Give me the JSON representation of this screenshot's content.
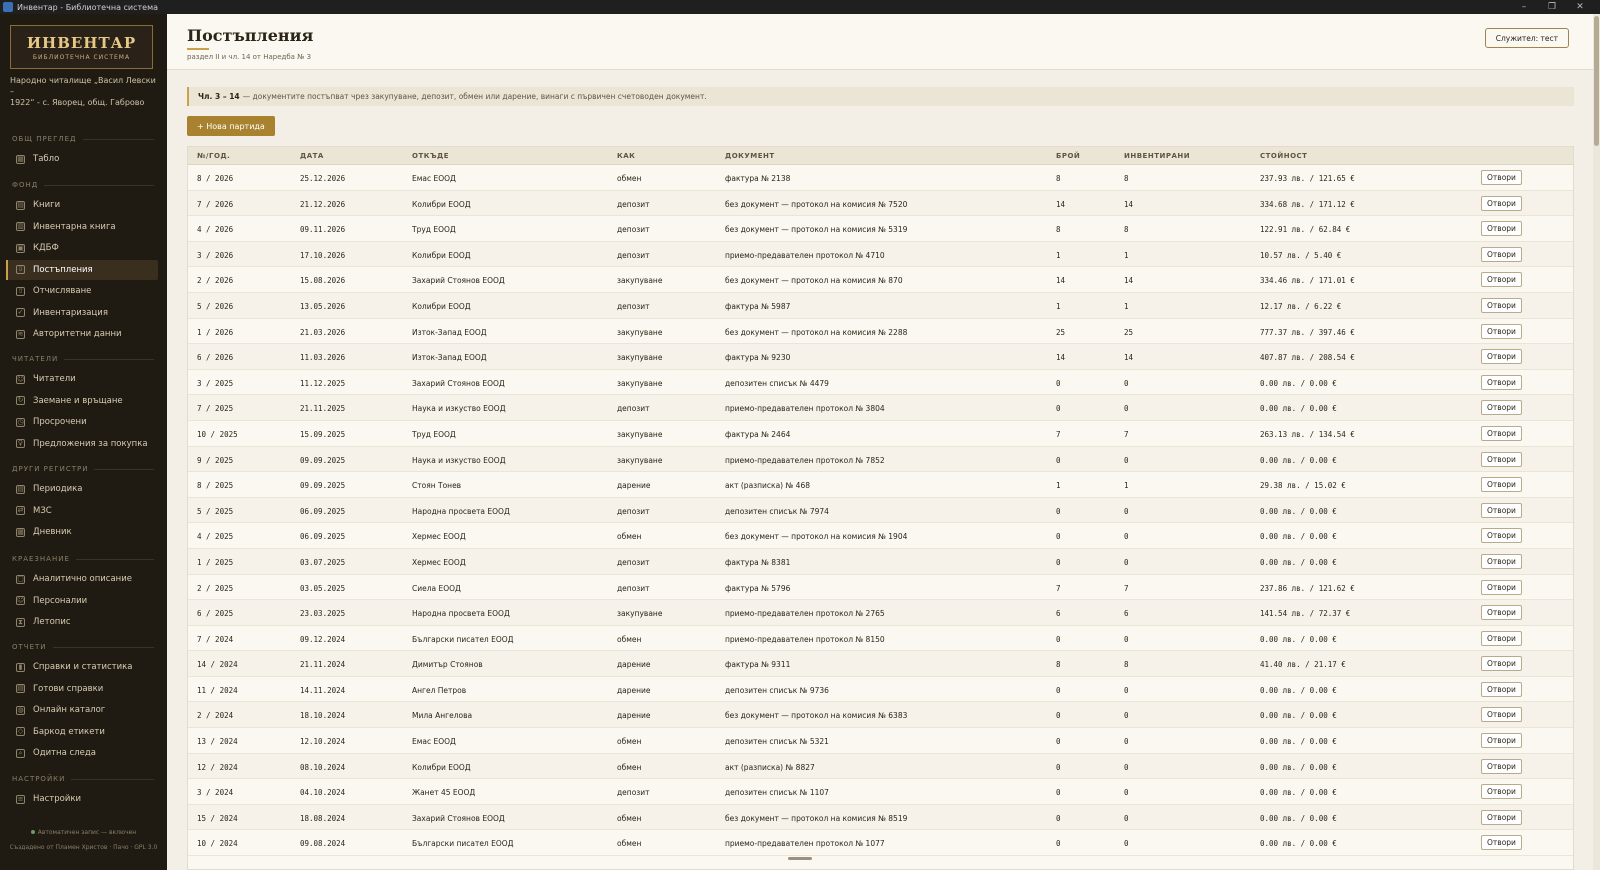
{
  "window": {
    "title": "Инвентар - Библиотечна система",
    "controls": [
      "–",
      "❐",
      "✕"
    ]
  },
  "sidebar": {
    "logo_title": "ИНВЕНТАР",
    "logo_subtitle": "БИБЛИОТЕЧНА СИСТЕМА",
    "org_line1": "Народно читалище „Васил Левски –",
    "org_line2": "1922“ - с. Яворец, общ. Габрово",
    "sections": [
      {
        "label": "ОБЩ ПРЕГЛЕД",
        "items": [
          {
            "label": "Табло",
            "icon": "dashboard-icon"
          }
        ]
      },
      {
        "label": "ФОНД",
        "items": [
          {
            "label": "Книги",
            "icon": "book-icon"
          },
          {
            "label": "Инвентарна книга",
            "icon": "ledger-icon"
          },
          {
            "label": "КДБФ",
            "icon": "card-icon"
          },
          {
            "label": "Постъпления",
            "icon": "inbox-icon"
          },
          {
            "label": "Отчисляване",
            "icon": "outbox-icon"
          },
          {
            "label": "Инвентаризация",
            "icon": "checklist-icon"
          },
          {
            "label": "Авторитетни данни",
            "icon": "layers-icon"
          }
        ]
      },
      {
        "label": "ЧИТАТЕЛИ",
        "items": [
          {
            "label": "Читатели",
            "icon": "users-icon"
          },
          {
            "label": "Заемане и връщане",
            "icon": "refresh-icon"
          },
          {
            "label": "Просрочени",
            "icon": "clock-icon"
          },
          {
            "label": "Предложения за покупка",
            "icon": "bulb-icon"
          }
        ]
      },
      {
        "label": "ДРУГИ РЕГИСТРИ",
        "items": [
          {
            "label": "Периодика",
            "icon": "newspaper-icon"
          },
          {
            "label": "МЗС",
            "icon": "exchange-icon"
          },
          {
            "label": "Дневник",
            "icon": "calendar-icon"
          }
        ]
      },
      {
        "label": "КРАЕЗНАНИЕ",
        "items": [
          {
            "label": "Аналитично описание",
            "icon": "document-icon"
          },
          {
            "label": "Персоналии",
            "icon": "person-icon"
          },
          {
            "label": "Летопис",
            "icon": "hourglass-icon"
          }
        ]
      },
      {
        "label": "ОТЧЕТИ",
        "items": [
          {
            "label": "Справки и статистика",
            "icon": "chart-icon"
          },
          {
            "label": "Готови справки",
            "icon": "report-icon"
          },
          {
            "label": "Онлайн каталог",
            "icon": "globe-icon"
          },
          {
            "label": "Баркод етикети",
            "icon": "tag-icon"
          },
          {
            "label": "Одитна следа",
            "icon": "search-icon"
          }
        ]
      },
      {
        "label": "НАСТРОЙКИ",
        "items": [
          {
            "label": "Настройки",
            "icon": "sliders-icon"
          }
        ]
      }
    ],
    "active_item": "Постъпления",
    "footer_status": "Автоматичен запис — включен",
    "footer_credits": "Създадено от Пламен Христов · Пачо · GPL 3.0"
  },
  "header": {
    "title": "Постъпления",
    "subtitle": "раздел II и чл. 14 от Наредба № 3",
    "user_button": "Служител: тест"
  },
  "note": {
    "bold": "Чл. 3 – 14",
    "text": "— документите постъпват чрез закупуване, депозит, обмен или дарение, винаги с първичен счетоводен документ."
  },
  "new_button": "+ Нова партида",
  "table": {
    "columns": [
      "№/ГОД.",
      "ДАТА",
      "ОТКЪДЕ",
      "КАК",
      "ДОКУМЕНТ",
      "БРОЙ",
      "ИНВЕНТИРАНИ",
      "СТОЙНОСТ",
      ""
    ],
    "open_label": "Отвори",
    "rows": [
      [
        "8 / 2026",
        "25.12.2026",
        "Емас ЕООД",
        "обмен",
        "фактура № 2138",
        "8",
        "8",
        "237.93 лв. / 121.65 €"
      ],
      [
        "7 / 2026",
        "21.12.2026",
        "Колибри ЕООД",
        "депозит",
        "без документ — протокол на комисия № 7520",
        "14",
        "14",
        "334.68 лв. / 171.12 €"
      ],
      [
        "4 / 2026",
        "09.11.2026",
        "Труд ЕООД",
        "депозит",
        "без документ — протокол на комисия № 5319",
        "8",
        "8",
        "122.91 лв. / 62.84 €"
      ],
      [
        "3 / 2026",
        "17.10.2026",
        "Колибри ЕООД",
        "депозит",
        "приемо-предавателен протокол № 4710",
        "1",
        "1",
        "10.57 лв. / 5.40 €"
      ],
      [
        "2 / 2026",
        "15.08.2026",
        "Захарий Стоянов ЕООД",
        "закупуване",
        "без документ — протокол на комисия № 870",
        "14",
        "14",
        "334.46 лв. / 171.01 €"
      ],
      [
        "5 / 2026",
        "13.05.2026",
        "Колибри ЕООД",
        "депозит",
        "фактура № 5987",
        "1",
        "1",
        "12.17 лв. / 6.22 €"
      ],
      [
        "1 / 2026",
        "21.03.2026",
        "Изток-Запад ЕООД",
        "закупуване",
        "без документ — протокол на комисия № 2288",
        "25",
        "25",
        "777.37 лв. / 397.46 €"
      ],
      [
        "6 / 2026",
        "11.03.2026",
        "Изток-Запад ЕООД",
        "закупуване",
        "фактура № 9230",
        "14",
        "14",
        "407.87 лв. / 208.54 €"
      ],
      [
        "3 / 2025",
        "11.12.2025",
        "Захарий Стоянов ЕООД",
        "закупуване",
        "депозитен списък № 4479",
        "0",
        "0",
        "0.00 лв. / 0.00 €"
      ],
      [
        "7 / 2025",
        "21.11.2025",
        "Наука и изкуство ЕООД",
        "депозит",
        "приемо-предавателен протокол № 3804",
        "0",
        "0",
        "0.00 лв. / 0.00 €"
      ],
      [
        "10 / 2025",
        "15.09.2025",
        "Труд ЕООД",
        "закупуване",
        "фактура № 2464",
        "7",
        "7",
        "263.13 лв. / 134.54 €"
      ],
      [
        "9 / 2025",
        "09.09.2025",
        "Наука и изкуство ЕООД",
        "закупуване",
        "приемо-предавателен протокол № 7852",
        "0",
        "0",
        "0.00 лв. / 0.00 €"
      ],
      [
        "8 / 2025",
        "09.09.2025",
        "Стоян Тонев",
        "дарение",
        "акт (разписка) № 468",
        "1",
        "1",
        "29.38 лв. / 15.02 €"
      ],
      [
        "5 / 2025",
        "06.09.2025",
        "Народна просвета ЕООД",
        "депозит",
        "депозитен списък № 7974",
        "0",
        "0",
        "0.00 лв. / 0.00 €"
      ],
      [
        "4 / 2025",
        "06.09.2025",
        "Хермес ЕООД",
        "обмен",
        "без документ — протокол на комисия № 1904",
        "0",
        "0",
        "0.00 лв. / 0.00 €"
      ],
      [
        "1 / 2025",
        "03.07.2025",
        "Хермес ЕООД",
        "депозит",
        "фактура № 8381",
        "0",
        "0",
        "0.00 лв. / 0.00 €"
      ],
      [
        "2 / 2025",
        "03.05.2025",
        "Сиела ЕООД",
        "депозит",
        "фактура № 5796",
        "7",
        "7",
        "237.86 лв. / 121.62 €"
      ],
      [
        "6 / 2025",
        "23.03.2025",
        "Народна просвета ЕООД",
        "закупуване",
        "приемо-предавателен протокол № 2765",
        "6",
        "6",
        "141.54 лв. / 72.37 €"
      ],
      [
        "7 / 2024",
        "09.12.2024",
        "Български писател ЕООД",
        "обмен",
        "приемо-предавателен протокол № 8150",
        "0",
        "0",
        "0.00 лв. / 0.00 €"
      ],
      [
        "14 / 2024",
        "21.11.2024",
        "Димитър Стоянов",
        "дарение",
        "фактура № 9311",
        "8",
        "8",
        "41.40 лв. / 21.17 €"
      ],
      [
        "11 / 2024",
        "14.11.2024",
        "Ангел Петров",
        "дарение",
        "депозитен списък № 9736",
        "0",
        "0",
        "0.00 лв. / 0.00 €"
      ],
      [
        "2 / 2024",
        "18.10.2024",
        "Мила Ангелова",
        "дарение",
        "без документ — протокол на комисия № 6383",
        "0",
        "0",
        "0.00 лв. / 0.00 €"
      ],
      [
        "13 / 2024",
        "12.10.2024",
        "Емас ЕООД",
        "обмен",
        "депозитен списък № 5321",
        "0",
        "0",
        "0.00 лв. / 0.00 €"
      ],
      [
        "12 / 2024",
        "08.10.2024",
        "Колибри ЕООД",
        "обмен",
        "акт (разписка) № 8827",
        "0",
        "0",
        "0.00 лв. / 0.00 €"
      ],
      [
        "3 / 2024",
        "04.10.2024",
        "Жанет 45 ЕООД",
        "депозит",
        "депозитен списък № 1107",
        "0",
        "0",
        "0.00 лв. / 0.00 €"
      ],
      [
        "15 / 2024",
        "18.08.2024",
        "Захарий Стоянов ЕООД",
        "обмен",
        "без документ — протокол на комисия № 8519",
        "0",
        "0",
        "0.00 лв. / 0.00 €"
      ],
      [
        "10 / 2024",
        "09.08.2024",
        "Български писател ЕООД",
        "обмен",
        "приемо-предавателен протокол № 1077",
        "0",
        "0",
        "0.00 лв. / 0.00 €"
      ]
    ]
  },
  "colors": {
    "sidebar_bg": "#1f1a12",
    "accent": "#c9a14b",
    "primary_button": "#a8822f",
    "page_bg": "#f3efe6"
  }
}
